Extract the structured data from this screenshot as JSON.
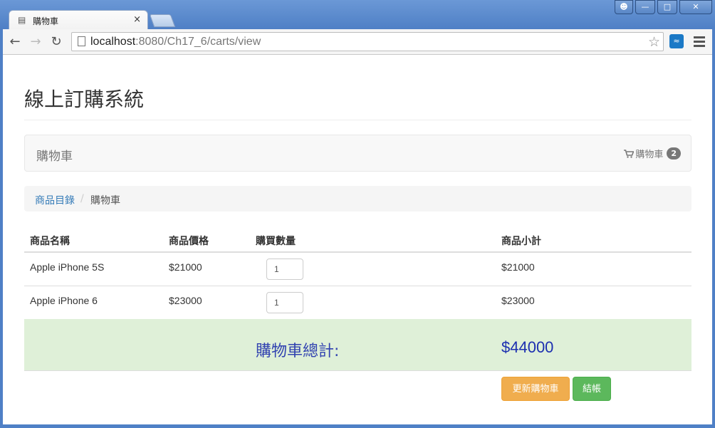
{
  "browser": {
    "tab_title": "購物車",
    "tab_close": "×",
    "url_host": "localhost",
    "url_rest": ":8080/Ch17_6/carts/view"
  },
  "header": {
    "site_title": "線上訂購系統"
  },
  "navbar": {
    "brand": "購物車",
    "cart_label": "購物車",
    "cart_count": "2"
  },
  "breadcrumb": {
    "link": "商品目錄",
    "separator": "/",
    "active": "購物車"
  },
  "table": {
    "headers": {
      "name": "商品名稱",
      "price": "商品價格",
      "quantity": "購買數量",
      "subtotal": "商品小計"
    },
    "rows": [
      {
        "name": "Apple iPhone 5S",
        "price": "$21000",
        "quantity": "1",
        "subtotal": "$21000"
      },
      {
        "name": "Apple iPhone 6",
        "price": "$23000",
        "quantity": "1",
        "subtotal": "$23000"
      }
    ],
    "total_label": "購物車總計:",
    "total_value": "$44000"
  },
  "actions": {
    "update_label": "更新購物車",
    "checkout_label": "結帳"
  },
  "colors": {
    "total_row_bg": "#dff0d8",
    "update_button": "#f0ad4e",
    "checkout_button": "#5cb85c",
    "link": "#337ab7"
  }
}
